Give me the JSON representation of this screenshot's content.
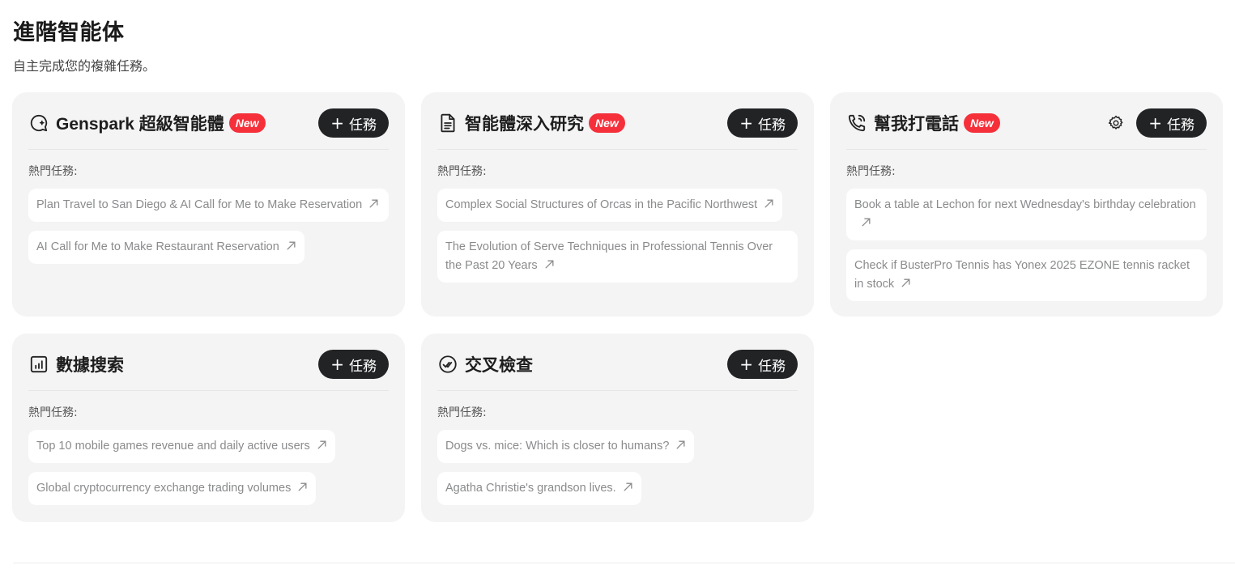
{
  "page": {
    "title": "進階智能体",
    "subtitle": "自主完成您的複雜任務。"
  },
  "common": {
    "task_button_plus": "+",
    "task_button_label": "任務",
    "popular_label": "熱門任務:",
    "new_badge": "New"
  },
  "cards": [
    {
      "id": "super-agent",
      "icon": "chat-sparkle-icon",
      "title": "Genspark 超級智能體",
      "has_new": true,
      "tasks": [
        "Plan Travel to San Diego & AI Call for Me to Make Reservation",
        "AI Call for Me to Make Restaurant Reservation"
      ]
    },
    {
      "id": "deep-research",
      "icon": "document-icon",
      "title": "智能體深入研究",
      "has_new": true,
      "tasks": [
        "Complex Social Structures of Orcas in the Pacific Northwest",
        "The Evolution of Serve Techniques in Professional Tennis Over the Past 20 Years"
      ]
    },
    {
      "id": "call-for-me",
      "icon": "phone-call-icon",
      "title": "幫我打電話",
      "has_new": true,
      "has_settings": true,
      "tasks": [
        "Book a table at Lechon for next Wednesday's birthday celebration",
        "Check if BusterPro Tennis has Yonex 2025 EZONE tennis racket in stock"
      ]
    },
    {
      "id": "data-search",
      "icon": "bar-chart-icon",
      "title": "數據搜索",
      "has_new": false,
      "tasks": [
        "Top 10 mobile games revenue and daily active users",
        "Global cryptocurrency exchange trading volumes"
      ]
    },
    {
      "id": "cross-check",
      "icon": "double-check-circle-icon",
      "title": "交叉檢查",
      "has_new": false,
      "tasks": [
        "Dogs vs. mice: Which is closer to humans?",
        "Agatha Christie's grandson lives."
      ]
    }
  ],
  "colors": {
    "card_bg": "#f4f4f4",
    "badge_red": "#f5303a",
    "button_dark": "#222325",
    "task_text": "#8a8b8d"
  }
}
